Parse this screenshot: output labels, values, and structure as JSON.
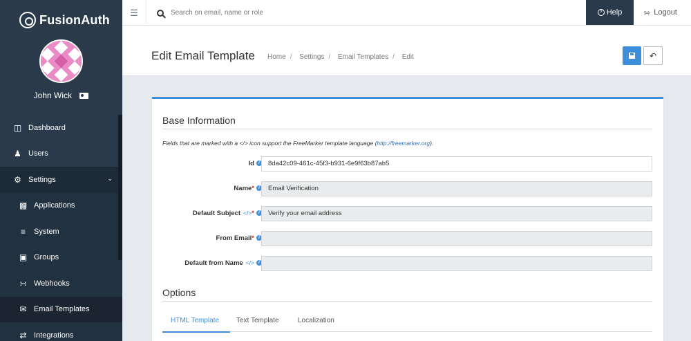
{
  "app": {
    "brand": "FusionAuth"
  },
  "user": {
    "name": "John Wick"
  },
  "sidebar": {
    "items": [
      {
        "label": "Dashboard",
        "icon": "dashboard-icon"
      },
      {
        "label": "Users",
        "icon": "users-icon"
      },
      {
        "label": "Settings",
        "icon": "gear-icon"
      },
      {
        "label": "Applications",
        "icon": "cube-icon"
      },
      {
        "label": "System",
        "icon": "sliders-icon"
      },
      {
        "label": "Groups",
        "icon": "groups-icon"
      },
      {
        "label": "Webhooks",
        "icon": "rss-icon"
      },
      {
        "label": "Email Templates",
        "icon": "envelope-icon"
      },
      {
        "label": "Integrations",
        "icon": "exchange-icon"
      }
    ]
  },
  "topbar": {
    "search_placeholder": "Search on email, name or role",
    "help_label": "Help",
    "logout_label": "Logout"
  },
  "page": {
    "title": "Edit Email Template",
    "breadcrumb": [
      "Home",
      "Settings",
      "Email Templates",
      "Edit"
    ]
  },
  "form": {
    "base_title": "Base Information",
    "hint_text": "Fields that are marked with a </> icon support the FreeMarker template language (",
    "hint_link": "http://freemarker.org",
    "hint_end": ").",
    "fields": [
      {
        "label": "Id",
        "value": "8da42c09-461c-45f3-b931-6e9f63b87ab5"
      },
      {
        "label": "Name",
        "value": "Email Verification"
      },
      {
        "label": "Default Subject",
        "value": "Verify your email address"
      },
      {
        "label": "From Email",
        "value": ""
      },
      {
        "label": "Default from Name",
        "value": ""
      }
    ],
    "options_title": "Options",
    "tabs": [
      "HTML Template",
      "Text Template",
      "Localization"
    ]
  },
  "colors": {
    "accent": "#3d8fdb",
    "sidebar": "#2b3a4a",
    "required": "#c0392b"
  }
}
